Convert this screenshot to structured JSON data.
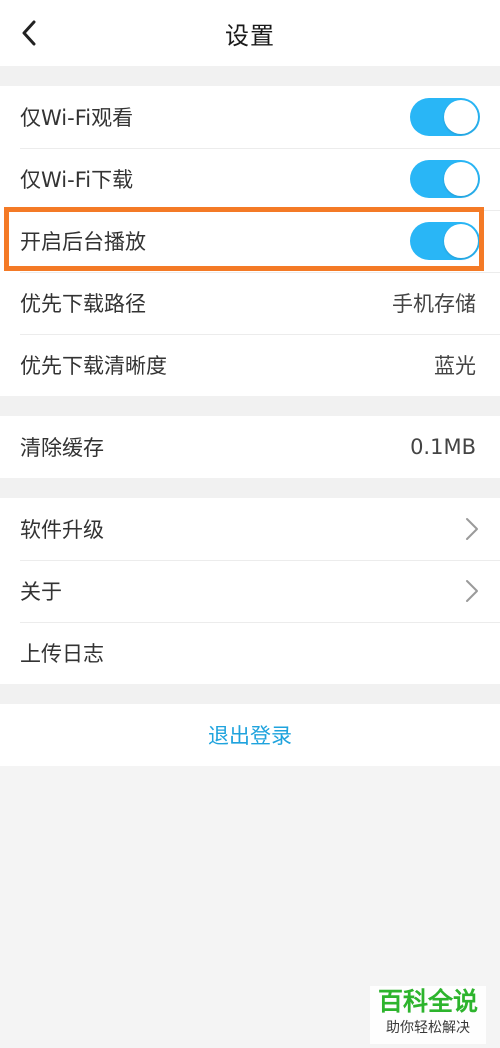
{
  "header": {
    "title": "设置",
    "back_icon": "chevron-left-icon"
  },
  "group1": {
    "wifi_watch": {
      "label": "仅Wi-Fi观看",
      "enabled": true
    },
    "wifi_download": {
      "label": "仅Wi-Fi下载",
      "enabled": true
    },
    "background_play": {
      "label": "开启后台播放",
      "enabled": true
    },
    "download_path": {
      "label": "优先下载路径",
      "value": "手机存储"
    },
    "download_quality": {
      "label": "优先下载清晰度",
      "value": "蓝光"
    }
  },
  "group2": {
    "clear_cache": {
      "label": "清除缓存",
      "value": "0.1MB"
    }
  },
  "group3": {
    "upgrade": {
      "label": "软件升级"
    },
    "about": {
      "label": "关于"
    },
    "upload_log": {
      "label": "上传日志"
    }
  },
  "logout": {
    "label": "退出登录"
  },
  "watermark": {
    "title": "百科全说",
    "subtitle": "助你轻松解决"
  },
  "colors": {
    "toggle_on": "#29b6f6",
    "highlight": "#f47a26",
    "logout_text": "#1fa3dd",
    "watermark_green": "#2db42d"
  }
}
